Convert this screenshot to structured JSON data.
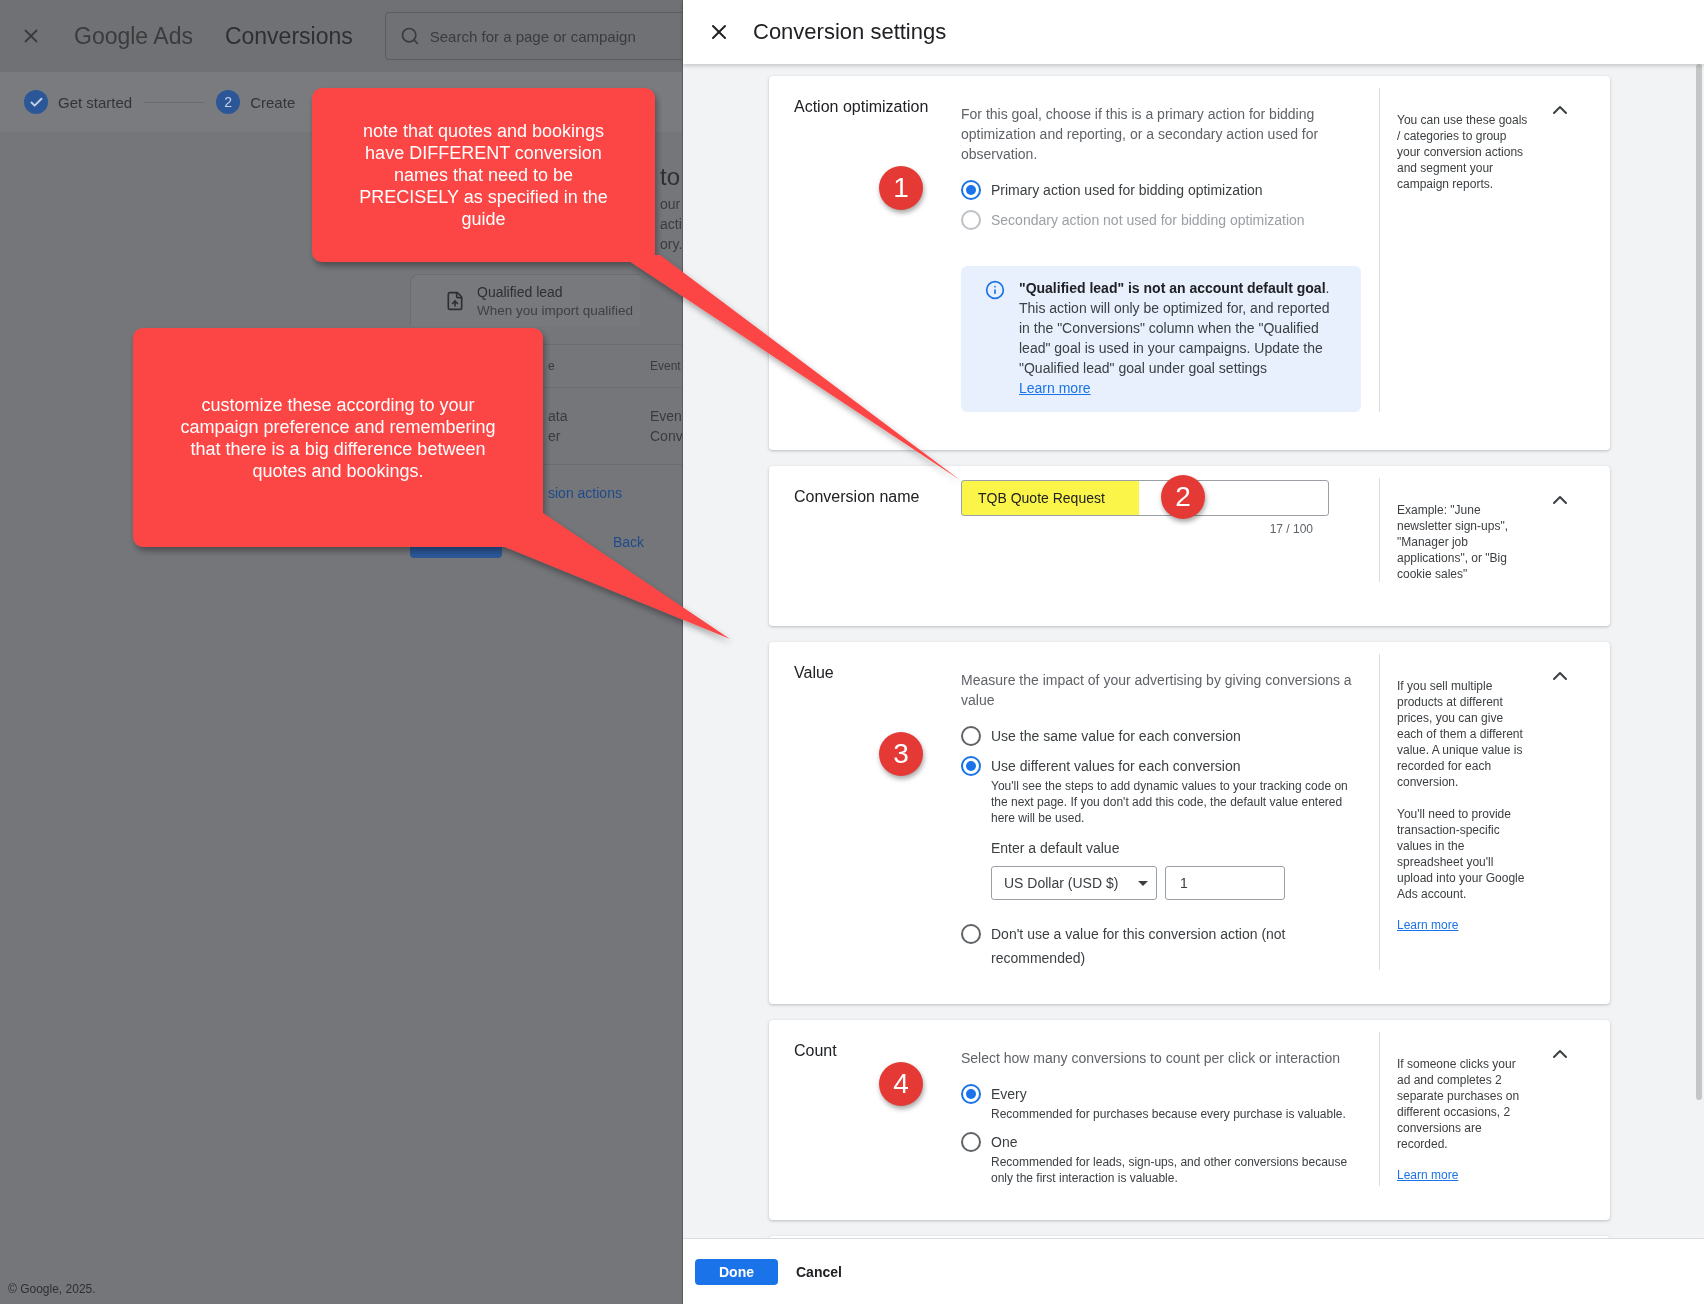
{
  "background_page": {
    "header": {
      "product": "Google Ads",
      "section": "Conversions",
      "search": {
        "placeholder": "Search for a page or campaign"
      }
    },
    "stepper": [
      {
        "label": "Get started",
        "completed": true
      },
      {
        "number": "2",
        "label": "Create",
        "completed": false
      }
    ],
    "heading_fragments": [
      "to",
      "our",
      "acti",
      "ory."
    ],
    "goal_card": {
      "title": "Qualified lead",
      "subtitle": "When you import qualified"
    },
    "table_fragments": {
      "header": [
        "e",
        "Event"
      ],
      "rows": [
        [
          "ata",
          "Even"
        ],
        [
          "er",
          "Conv"
        ]
      ]
    },
    "link": "sion actions",
    "buttons": [
      {
        "kind": "primary"
      },
      {
        "label": "Back",
        "kind": "text"
      }
    ],
    "copyright": "© Google, 2025."
  },
  "panel": {
    "title": "Conversion settings",
    "sections": [
      {
        "title": "Action optimization",
        "marker": "1",
        "expanded": true,
        "description": "For this goal, choose if this is a primary action for bidding optimization and reporting, or a secondary action used for observation.",
        "options": [
          {
            "label": "Primary action used for bidding optimization",
            "selected": true,
            "disabled": false
          },
          {
            "label": "Secondary action not used for bidding optimization",
            "selected": false,
            "disabled": true
          }
        ],
        "notice": {
          "text": "**\"Qualified lead\" is not an account default goal**. This action will only be optimized for, and reported in the \"Conversions\" column when the \"Qualified lead\" goal is used in your campaigns. Update the \"Qualified lead\" goal under goal settings",
          "link": "Learn more"
        },
        "help": [
          "You can use these goals / categories to group your conversion actions and segment your campaign reports."
        ]
      },
      {
        "title": "Conversion name",
        "marker": "2",
        "expanded": true,
        "field": {
          "value": "TQB Quote Request",
          "highlighted": true,
          "counter": "17 / 100"
        },
        "help": [
          "Example: \"June newsletter sign-ups\", \"Manager job applications\", or \"Big cookie sales\""
        ]
      },
      {
        "title": "Value",
        "marker": "3",
        "expanded": true,
        "description": "Measure the impact of your advertising by giving conversions a value",
        "options": [
          {
            "label": "Use the same value for each conversion",
            "selected": false,
            "disabled": false
          },
          {
            "label": "Use different values for each conversion",
            "selected": true,
            "disabled": false,
            "detail": "You'll see the steps to add dynamic values to your tracking code on the next page. If you don't add this code, the default value entered here will be used.",
            "default_value": {
              "label": "Enter a default value",
              "currency": "US Dollar (USD $)",
              "amount": "1"
            }
          },
          {
            "label": "Don't use a value for this conversion action (not recommended)",
            "selected": false,
            "disabled": false
          }
        ],
        "help": [
          "If you sell multiple products at different prices, you can give each of them a different value. A unique value is recorded for each conversion.",
          "You'll need to provide transaction-specific values in the spreadsheet you'll upload into your Google Ads account."
        ],
        "help_link": "Learn more"
      },
      {
        "title": "Count",
        "marker": "4",
        "expanded": true,
        "description": "Select how many conversions to count per click or interaction",
        "options": [
          {
            "label": "Every",
            "selected": true,
            "disabled": false,
            "detail": "Recommended for purchases because every purchase is valuable."
          },
          {
            "label": "One",
            "selected": false,
            "disabled": false,
            "detail": "Recommended for leads, sign-ups, and other conversions because only the first interaction is valuable."
          }
        ],
        "help": [
          "If someone clicks your ad and completes 2 separate purchases on different occasions, 2 conversions are recorded."
        ],
        "help_link": "Learn more"
      }
    ],
    "footer_buttons": [
      {
        "label": "Done",
        "kind": "primary"
      },
      {
        "label": "Cancel",
        "kind": "text"
      }
    ]
  },
  "callouts": [
    {
      "text": "note that quotes and bookings have DIFFERENT conversion names that need to be PRECISELY as specified in the guide"
    },
    {
      "text": "customize these according to your campaign preference and remembering that there is a big difference between quotes and bookings."
    }
  ]
}
